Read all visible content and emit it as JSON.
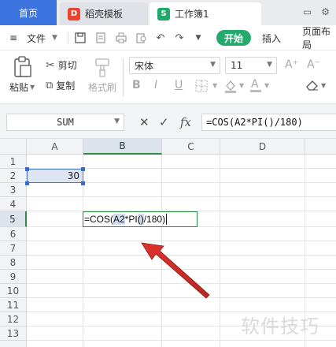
{
  "tabs": {
    "home": "首页",
    "template": "稻壳模板",
    "template_icon_glyph": "D",
    "workbook": "工作簿1",
    "workbook_icon_glyph": "S"
  },
  "menu": {
    "file": "文件",
    "start": "开始",
    "insert": "插入",
    "page_layout": "页面布局"
  },
  "ribbon": {
    "paste": "粘贴",
    "cut": "剪切",
    "copy": "复制",
    "format_painter": "格式刷",
    "font_name": "宋体",
    "font_size": "11",
    "bold": "B",
    "italic": "I",
    "underline": "U",
    "grow_font": "A⁺",
    "shrink_font": "A⁻"
  },
  "formula_bar": {
    "name_box": "SUM",
    "cancel": "✕",
    "confirm": "✓",
    "fx": "fx",
    "formula": "=COS(A2*PI()/180)"
  },
  "grid": {
    "columns": [
      "A",
      "B",
      "C",
      "D"
    ],
    "rows": [
      "1",
      "2",
      "3",
      "4",
      "5",
      "6",
      "7",
      "8",
      "9",
      "10",
      "11",
      "12",
      "13"
    ],
    "selected_column": "B",
    "selected_row": "5",
    "cell_a2": "30",
    "cell_b5": {
      "prefix": "=COS(",
      "ref": "A2",
      "op": "*PI",
      "paren": "()",
      "suffix": "/180)"
    }
  },
  "colors": {
    "home_tab": "#3b74de",
    "start_button": "#26a96c",
    "arrow": "#d8302b",
    "selection_border": "#2f8a47",
    "ref_highlight": "#4a79c8"
  },
  "watermark": "软件技巧"
}
